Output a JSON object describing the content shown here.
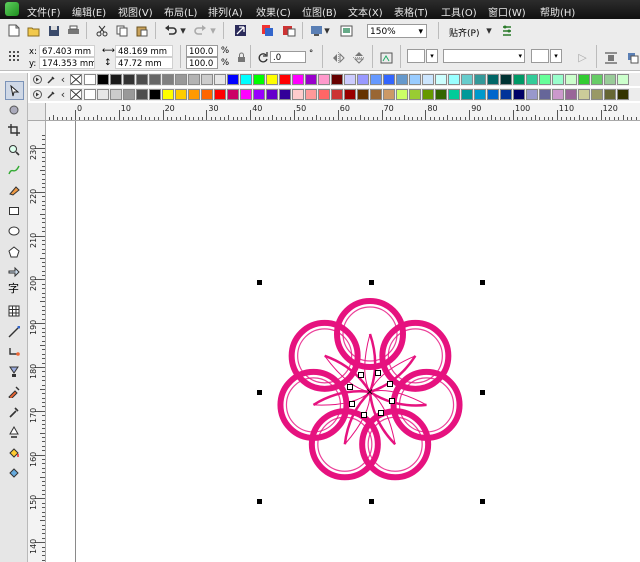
{
  "menu": [
    "文件(F)",
    "编辑(E)",
    "视图(V)",
    "布局(L)",
    "排列(A)",
    "效果(C)",
    "位图(B)",
    "文本(X)",
    "表格(T)",
    "工具(O)",
    "窗口(W)",
    "帮助(H)"
  ],
  "toolbar": {
    "zoom_value": "150%",
    "snap_label": "贴齐(P)"
  },
  "properties": {
    "x_label": "x:",
    "x_value": "67.403 mm",
    "y_label": "y:",
    "y_value": "174.353 mm",
    "width_value": "48.169 mm",
    "height_value": "47.72 mm",
    "scale_x": "100.0",
    "scale_y": "100.0",
    "percent": "%",
    "rotation": ".0",
    "degree": "°"
  },
  "palette_row1": [
    "#ffffff",
    "#000000",
    "#1a1a1a",
    "#333333",
    "#4d4d4d",
    "#666666",
    "#808080",
    "#999999",
    "#b3b3b3",
    "#cccccc",
    "#e6e6e6",
    "#0000ff",
    "#00ffff",
    "#00ff00",
    "#ffff00",
    "#ff0000",
    "#ff00ff",
    "#9900cc",
    "#ff99cc",
    "#660000",
    "#ccccff",
    "#9999ff",
    "#6699ff",
    "#3366ff",
    "#6699cc",
    "#99ccff",
    "#cce6ff",
    "#ccffff",
    "#99ffff",
    "#66cccc",
    "#339999",
    "#006666",
    "#003333",
    "#009966",
    "#33cc99",
    "#66ff99",
    "#99ffcc",
    "#ccffcc",
    "#33cc33",
    "#66cc66",
    "#99cc99",
    "#ccffcc"
  ],
  "palette_row2": [
    "#ffffff",
    "#e6e6e6",
    "#cccccc",
    "#999999",
    "#4d4d4d",
    "#000000",
    "#ffff00",
    "#ffcc00",
    "#ff9900",
    "#ff6600",
    "#ff0000",
    "#cc0066",
    "#ff00ff",
    "#9900ff",
    "#6600cc",
    "#330099",
    "#ffcccc",
    "#ff9999",
    "#ff6666",
    "#cc3333",
    "#990000",
    "#663300",
    "#996633",
    "#cc9966",
    "#ccff66",
    "#99cc33",
    "#669900",
    "#336600",
    "#00cc99",
    "#009999",
    "#0099cc",
    "#0066cc",
    "#003399",
    "#000066",
    "#9999cc",
    "#666699",
    "#cc99cc",
    "#996699",
    "#cccc99",
    "#999966",
    "#666633",
    "#333300"
  ],
  "ruler_h_labels": [
    "0",
    "10",
    "20",
    "30",
    "40",
    "50",
    "60",
    "70",
    "80",
    "90",
    "100",
    "110",
    "120"
  ],
  "ruler_v_labels": [
    "230",
    "220",
    "210",
    "200",
    "190",
    "180",
    "170",
    "160",
    "150",
    "140"
  ],
  "ruler_unit": "毫米",
  "colors": {
    "artwork": "#e6127f",
    "menubar": "#1e1e1e"
  }
}
